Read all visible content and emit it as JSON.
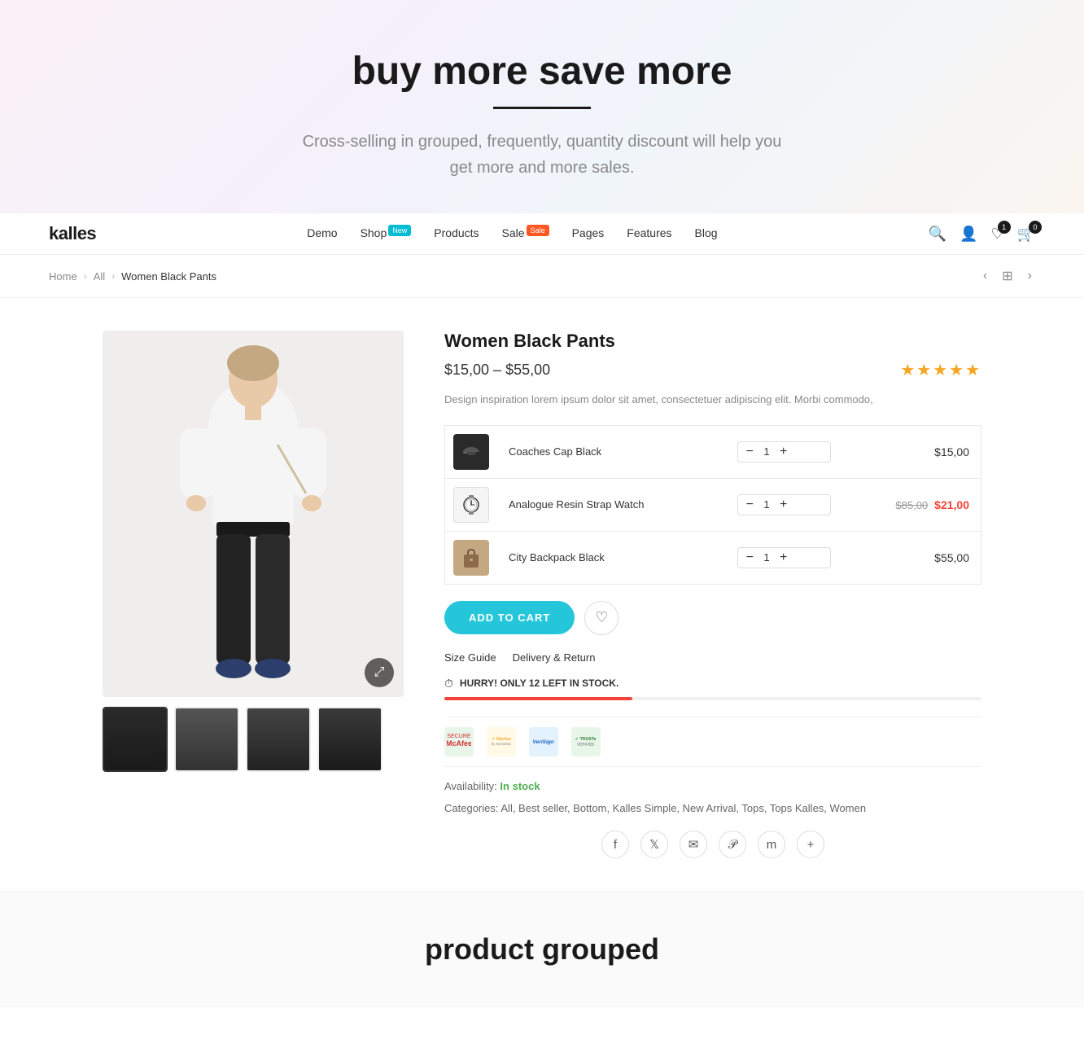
{
  "hero": {
    "title": "buy more save more",
    "subtitle": "Cross-selling in grouped, frequently,  quantity discount will help you get more and more sales."
  },
  "navbar": {
    "logo": "kalles",
    "links": [
      {
        "label": "Demo",
        "badge": null
      },
      {
        "label": "Shop",
        "badge": "New"
      },
      {
        "label": "Products",
        "badge": null
      },
      {
        "label": "Sale",
        "badge": "Sale"
      },
      {
        "label": "Pages",
        "badge": null
      },
      {
        "label": "Features",
        "badge": null
      },
      {
        "label": "Blog",
        "badge": null
      }
    ],
    "wishlist_count": "1",
    "cart_count": "0"
  },
  "breadcrumb": {
    "home": "Home",
    "all": "All",
    "current": "Women Black Pants"
  },
  "product": {
    "title": "Women Black Pants",
    "price": "$15,00 – $55,00",
    "description": "Design inspiration lorem ipsum dolor sit amet, consectetuer adipiscing elit. Morbi commodo,",
    "stars": "★★★★★",
    "items": [
      {
        "name": "Coaches Cap Black",
        "qty": 1,
        "price": "$15,00",
        "price_original": null,
        "price_sale": null,
        "type": "cap"
      },
      {
        "name": "Analogue Resin Strap Watch",
        "qty": 1,
        "price": "$85,00",
        "price_original": "$85,00",
        "price_sale": "$21,00",
        "type": "watch"
      },
      {
        "name": "City Backpack Black",
        "qty": 1,
        "price": "$55,00",
        "price_original": null,
        "price_sale": null,
        "type": "bag"
      }
    ],
    "add_to_cart": "ADD TO CART",
    "size_guide": "Size Guide",
    "delivery": "Delivery & Return",
    "stock_warning": "HURRY! ONLY 12 LEFT IN STOCK.",
    "availability_label": "Availability:",
    "availability_value": "In stock",
    "categories_label": "Categories:",
    "categories": "All, Best seller, Bottom, Kalles Simple, New Arrival, Tops, Tops Kalles, Women"
  },
  "bottom": {
    "title": "product grouped"
  }
}
